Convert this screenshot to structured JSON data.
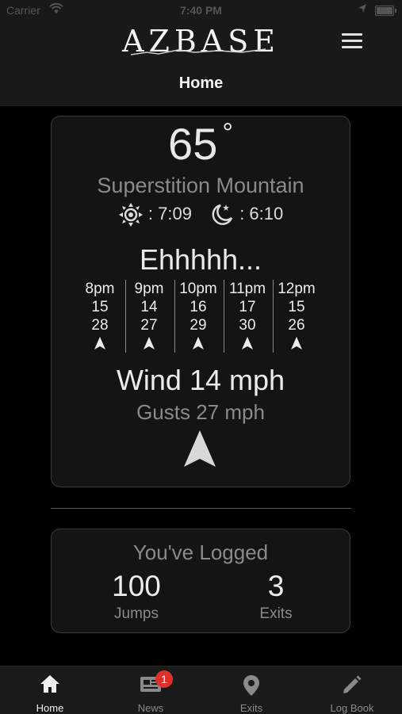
{
  "status_bar": {
    "carrier": "Carrier",
    "time": "7:40 PM"
  },
  "header": {
    "logo": "AZBASE",
    "title": "Home"
  },
  "weather": {
    "temperature": "65",
    "degree_symbol": "°",
    "location": "Superstition Mountain",
    "sunrise": ": 7:09",
    "sunset": ": 6:10",
    "verdict": "Ehhhhh...",
    "forecast": [
      {
        "time": "8pm",
        "wind": "15",
        "gust": "28"
      },
      {
        "time": "9pm",
        "wind": "14",
        "gust": "27"
      },
      {
        "time": "10pm",
        "wind": "16",
        "gust": "29"
      },
      {
        "time": "11pm",
        "wind": "17",
        "gust": "30"
      },
      {
        "time": "12pm",
        "wind": "15",
        "gust": "26"
      }
    ],
    "wind": "Wind 14 mph",
    "gusts": "Gusts 27 mph"
  },
  "logged": {
    "title": "You've Logged",
    "jumps_count": "100",
    "jumps_label": "Jumps",
    "exits_count": "3",
    "exits_label": "Exits"
  },
  "tab_bar": {
    "tabs": [
      {
        "label": "Home",
        "icon": "home-icon"
      },
      {
        "label": "News",
        "icon": "news-icon",
        "badge": "1"
      },
      {
        "label": "Exits",
        "icon": "map-pin-icon"
      },
      {
        "label": "Log Book",
        "icon": "pencil-icon"
      }
    ],
    "active_tab": "Home"
  },
  "colors": {
    "background": "#000000",
    "card": "#141414",
    "header": "#191919",
    "text_primary": "#ececec",
    "text_secondary": "#8a8a8a",
    "badge": "#e0302d"
  }
}
